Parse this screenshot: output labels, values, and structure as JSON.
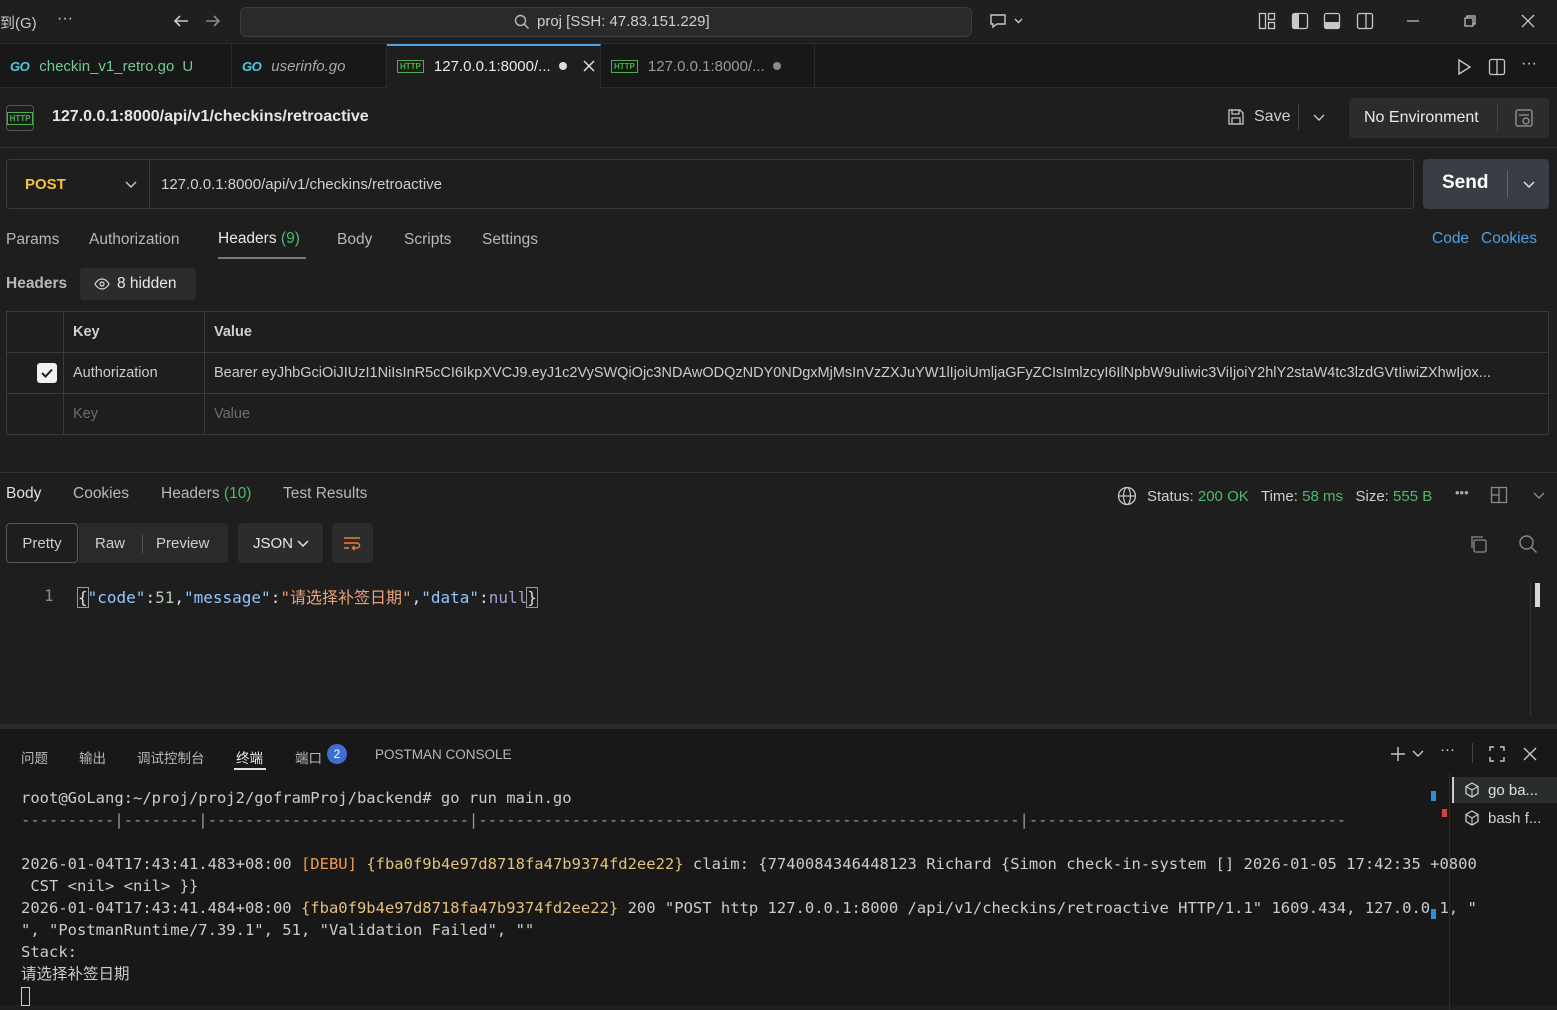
{
  "titlebar": {
    "menu_fragment": "到(G)",
    "more": "···",
    "search_text": "proj [SSH: 47.83.151.229]"
  },
  "tabs": [
    {
      "label": "checkin_v1_retro.go",
      "badge": "GO",
      "status": "U"
    },
    {
      "label": "userinfo.go",
      "badge": "GO"
    },
    {
      "label": "127.0.0.1:8000/...",
      "badge": "HTTP",
      "active": true
    },
    {
      "label": "127.0.0.1:8000/...",
      "badge": "HTTP"
    }
  ],
  "request": {
    "title": "127.0.0.1:8000/api/v1/checkins/retroactive",
    "save_label": "Save",
    "environment": "No Environment",
    "method": "POST",
    "url": "127.0.0.1:8000/api/v1/checkins/retroactive",
    "send_label": "Send",
    "subtabs": [
      "Params",
      "Authorization",
      "Headers",
      "Body",
      "Scripts",
      "Settings"
    ],
    "headers_count": "(9)",
    "code_link": "Code",
    "cookies_link": "Cookies",
    "headers_label": "Headers",
    "hidden_label": "8 hidden",
    "table_key_header": "Key",
    "table_value_header": "Value",
    "row_key": "Authorization",
    "row_value": "Bearer eyJhbGciOiJIUzI1NiIsInR5cCI6IkpXVCJ9.eyJ1c2VySWQiOjc3NDAwODQzNDY0NDgxMjMsInVzZXJuYW1lIjoiUmljaGFyZCIsImlzcyI6IlNpbW9uIiwic3ViIjoiY2hlY2staW4tc3lzdGVtIiwiZXhwIjox...",
    "placeholder_key": "Key",
    "placeholder_value": "Value"
  },
  "response": {
    "tabs": [
      "Body",
      "Cookies",
      "Headers",
      "Test Results"
    ],
    "headers_count": "(10)",
    "status_label": "Status:",
    "status_value": "200 OK",
    "time_label": "Time:",
    "time_value": "58 ms",
    "size_label": "Size:",
    "size_value": "555 B",
    "view_modes": [
      "Pretty",
      "Raw",
      "Preview"
    ],
    "format": "JSON",
    "line_number": "1",
    "json_parts": {
      "k1": "\"code\"",
      "v1": "51",
      "k2": "\"message\"",
      "v2": "\"请选择补签日期\"",
      "k3": "\"data\"",
      "v3": "null"
    }
  },
  "panel": {
    "tabs": [
      "问题",
      "输出",
      "调试控制台",
      "终端",
      "端口",
      "POSTMAN CONSOLE"
    ],
    "ports_badge": "2",
    "terminals": [
      "go ba...",
      "bash f..."
    ],
    "prompt": "root@GoLang:~/proj/proj2/goframProj/backend# go run main.go",
    "separator": "----------|--------|----------------------------|----------------------------------------------------------|----------------------------------",
    "log1_time": "2026-01-04T17:43:41.483+08:00",
    "log1_level": "[DEBU]",
    "log1_trace": "{fba0f9b4e97d8718fa47b9374fd2ee22}",
    "log1_rest": " claim: {7740084346448123 Richard {Simon check-in-system [] 2026-01-05 17:42:35 +0800",
    "log1_cont": " CST <nil> <nil> }}",
    "log2_time": "2026-01-04T17:43:41.484+08:00",
    "log2_trace": "{fba0f9b4e97d8718fa47b9374fd2ee22}",
    "log2_rest": " 200 \"POST http 127.0.0.1:8000 /api/v1/checkins/retroactive HTTP/1.1\" 1609.434, 127.0.0.1, \"",
    "log2_cont": "\", \"PostmanRuntime/7.39.1\", 51, \"Validation Failed\", \"\"",
    "stack": "Stack:",
    "stack_msg": "请选择补签日期"
  },
  "colors": {
    "accent_blue": "#4e9fe8",
    "status_green": "#4cbb68",
    "method_yellow": "#f5c242",
    "http_green": "#4caf50"
  }
}
